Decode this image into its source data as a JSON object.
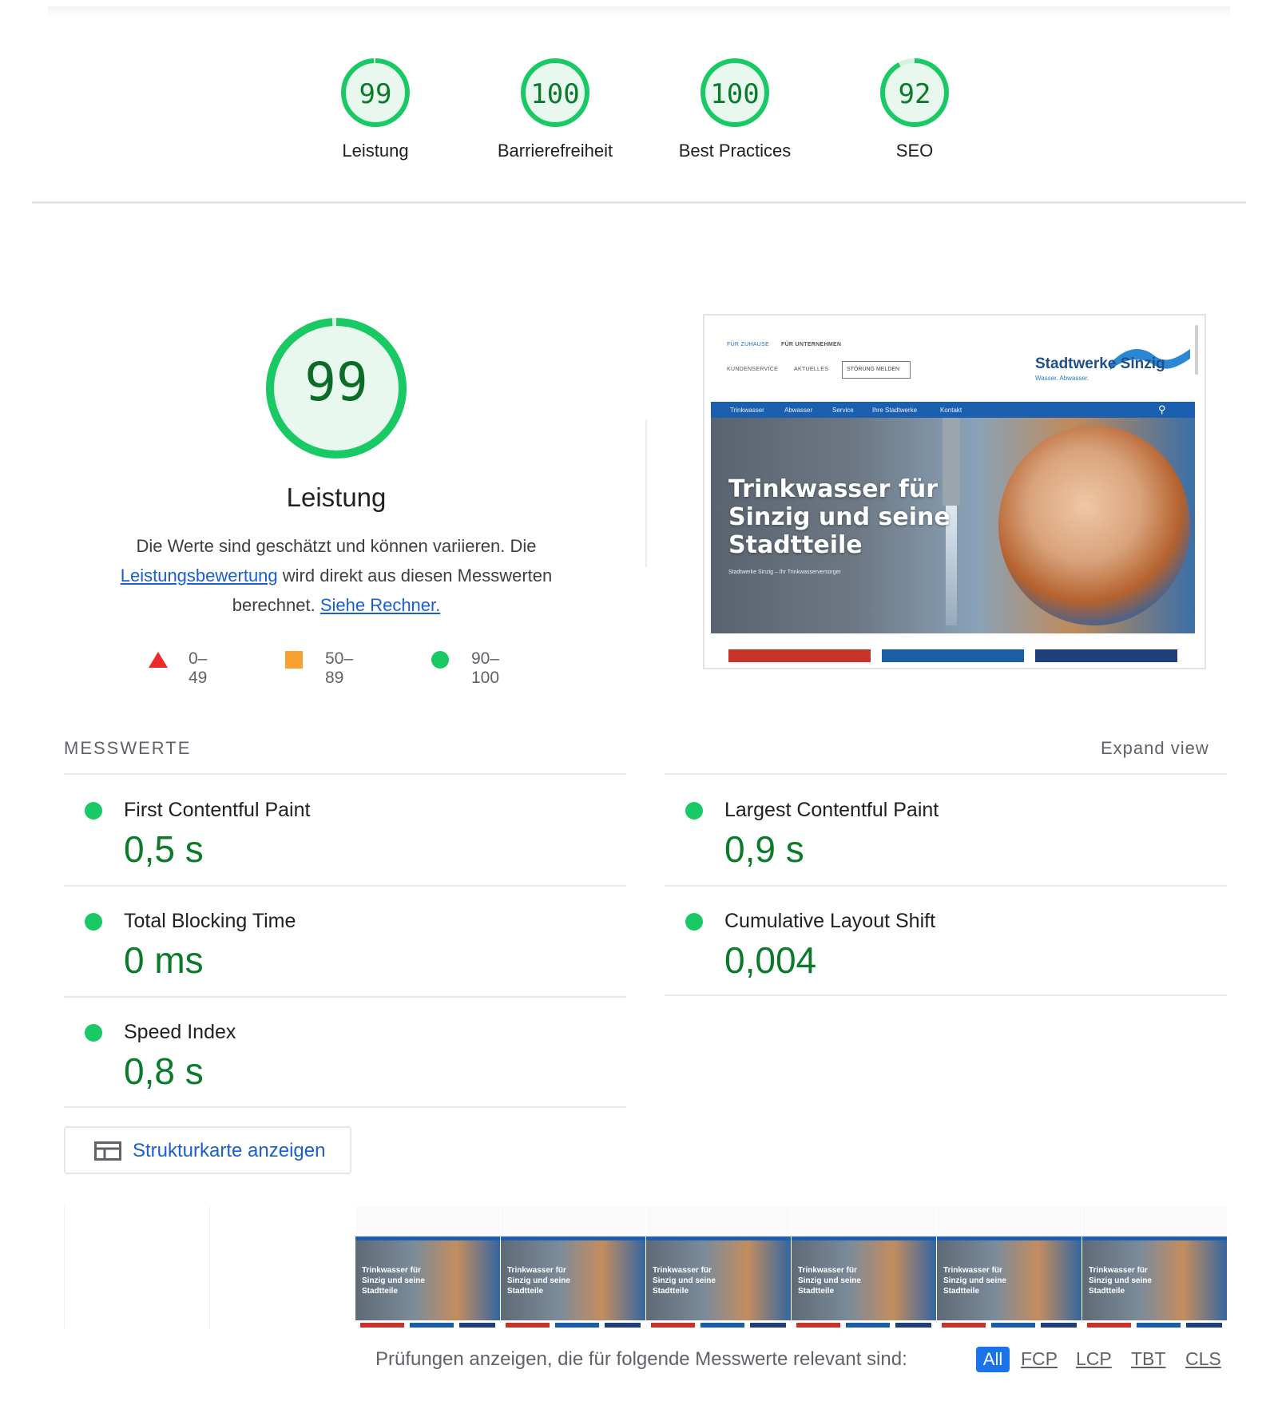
{
  "scores": [
    {
      "label": "Leistung",
      "value": "99",
      "fraction": 0.99
    },
    {
      "label": "Barrierefreiheit",
      "value": "100",
      "fraction": 1.0
    },
    {
      "label": "Best Practices",
      "value": "100",
      "fraction": 1.0
    },
    {
      "label": "SEO",
      "value": "92",
      "fraction": 0.92
    }
  ],
  "performance": {
    "score": "99",
    "fraction": 0.99,
    "title": "Leistung",
    "desc_part1": "Die Werte sind geschätzt und können variieren. Die ",
    "link1": "Leistungsbewertung",
    "desc_part2": " wird direkt aus diesen Messwerten berechnet. ",
    "link2": "Siehe Rechner."
  },
  "legend": [
    {
      "range": "0–49",
      "color": "#eb2b2b",
      "shape": "triangle"
    },
    {
      "range": "50–89",
      "color": "#f7a230",
      "shape": "square"
    },
    {
      "range": "90–100",
      "color": "#18c964",
      "shape": "circle"
    }
  ],
  "screenshot": {
    "top_links": [
      "FÜR ZUHAUSE",
      "FÜR UNTERNEHMEN"
    ],
    "sub_links": [
      "KUNDENSERVICE",
      "AKTUELLES"
    ],
    "button": "STÖRUNG MELDEN",
    "brand": "Stadtwerke Sinzig",
    "brand_sub": "Wasser. Abwasser.",
    "nav": [
      "Trinkwasser",
      "Abwasser",
      "Service",
      "Ihre Stadtwerke",
      "Kontakt"
    ],
    "hero_lines": [
      "Trinkwasser für",
      "Sinzig und seine",
      "Stadtteile"
    ],
    "hero_sub": "Stadtwerke Sinzig – Ihr Trinkwasserversorger",
    "bar_colors": [
      "#c8322b",
      "#1b5fa3",
      "#1e3f7a"
    ]
  },
  "metrics": {
    "header": "MESSWERTE",
    "expand": "Expand view",
    "items": [
      {
        "title": "First Contentful Paint",
        "value": "0,5 s"
      },
      {
        "title": "Largest Contentful Paint",
        "value": "0,9 s"
      },
      {
        "title": "Total Blocking Time",
        "value": "0 ms"
      },
      {
        "title": "Cumulative Layout Shift",
        "value": "0,004"
      },
      {
        "title": "Speed Index",
        "value": "0,8 s"
      }
    ]
  },
  "treemap_button": "Strukturkarte anzeigen",
  "filmstrip": {
    "blank_frames": 2,
    "loaded_frames": 6,
    "frame_lines": [
      "Trinkwasser für",
      "Sinzig und seine",
      "Stadtteile"
    ]
  },
  "filter": {
    "label": "Prüfungen anzeigen, die für folgende Messwerte relevant sind:",
    "chips": [
      "All",
      "FCP",
      "LCP",
      "TBT",
      "CLS"
    ],
    "active": "All"
  },
  "colors": {
    "pass": "#0b7a2b",
    "pass_ring": "#18c964",
    "link": "#1a5fd0"
  }
}
